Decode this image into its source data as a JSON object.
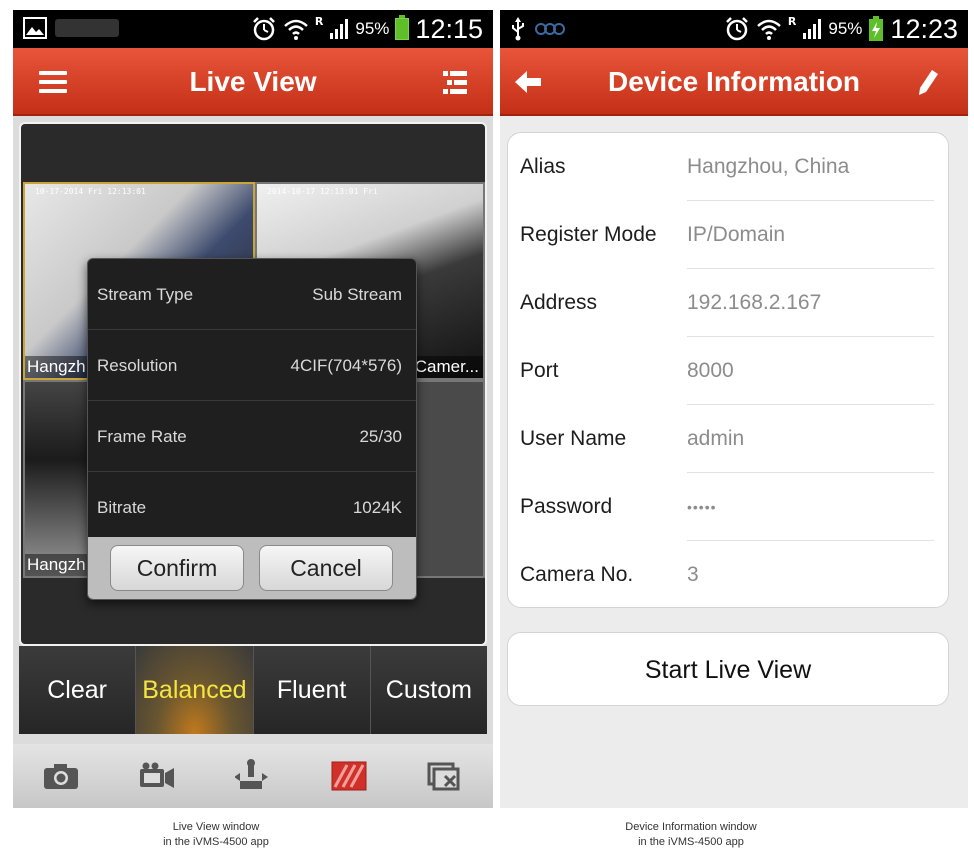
{
  "live_view": {
    "status": {
      "battery": "95%",
      "time": "12:15",
      "signal_r": "R"
    },
    "title": "Live View",
    "tiles": [
      {
        "timestamp": "10-17-2014 Fri 12:13:01",
        "label": "Hangzh"
      },
      {
        "timestamp": "2014-10-17 12:13:01 Fri",
        "label": "Camer..."
      },
      {
        "timestamp": "",
        "label": "Hangzh"
      },
      {
        "timestamp": "",
        "label": ""
      }
    ],
    "popup": {
      "rows": [
        {
          "key": "Stream Type",
          "value": "Sub Stream"
        },
        {
          "key": "Resolution",
          "value": "4CIF(704*576)"
        },
        {
          "key": "Frame Rate",
          "value": "25/30"
        },
        {
          "key": "Bitrate",
          "value": "1024K"
        }
      ],
      "confirm": "Confirm",
      "cancel": "Cancel"
    },
    "quality_tabs": [
      "Clear",
      "Balanced",
      "Fluent",
      "Custom"
    ],
    "active_tab": "Balanced",
    "caption_line1": "Live View window",
    "caption_line2": "in the iVMS-4500 app"
  },
  "device_info": {
    "status": {
      "battery": "95%",
      "time": "12:23",
      "signal_r": "R"
    },
    "title": "Device Information",
    "rows": [
      {
        "key": "Alias",
        "value": "Hangzhou, China"
      },
      {
        "key": "Register Mode",
        "value": "IP/Domain"
      },
      {
        "key": "Address",
        "value": "192.168.2.167"
      },
      {
        "key": "Port",
        "value": "8000"
      },
      {
        "key": "User Name",
        "value": "admin"
      },
      {
        "key": "Password",
        "value": "•••••"
      },
      {
        "key": "Camera No.",
        "value": "3"
      }
    ],
    "start_button": "Start Live View",
    "caption_line1": "Device Information window",
    "caption_line2": "in the iVMS-4500 app"
  },
  "colors": {
    "appbar": "#d8401f",
    "active_tab_text": "#f4e640",
    "record_icon": "#d0302a"
  }
}
